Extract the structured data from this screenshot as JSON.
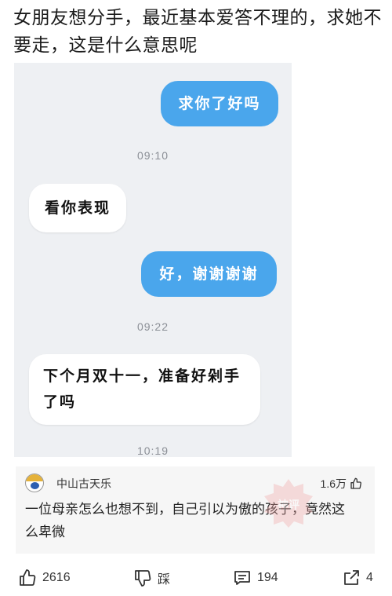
{
  "post": {
    "title": "女朋友想分手，最近基本爱答不理的，求她不要走，这是什么意思呢"
  },
  "chat": {
    "messages": [
      {
        "side": "out",
        "text": "求你了好吗"
      },
      {
        "time": "09:10"
      },
      {
        "side": "in",
        "text": "看你表现"
      },
      {
        "side": "out",
        "text": "好，谢谢谢谢"
      },
      {
        "time": "09:22"
      },
      {
        "side": "in",
        "text": "下个月双十一，准备好剁手了吗"
      },
      {
        "time": "10:19"
      }
    ],
    "m1": "求你了好吗",
    "t1": "09:10",
    "m2": "看你表现",
    "m3": "好，谢谢谢谢",
    "t2": "09:22",
    "m4": "下个月双十一，准备好剁手了吗",
    "t3": "10:19",
    "colors": {
      "outgoing": "#4aa6ec",
      "incoming": "#ffffff",
      "background": "#eef0f3"
    }
  },
  "comment": {
    "username": "中山古天乐",
    "likes": "1.6万",
    "text": "一位母亲怎么也想不到，自己引以为傲的孩子，竟然这么卑微",
    "watermark_icon": "hot-comment-stamp-icon"
  },
  "actions": {
    "like_count": "2616",
    "dislike_label": "踩",
    "comment_count": "194",
    "share_count": "4"
  }
}
